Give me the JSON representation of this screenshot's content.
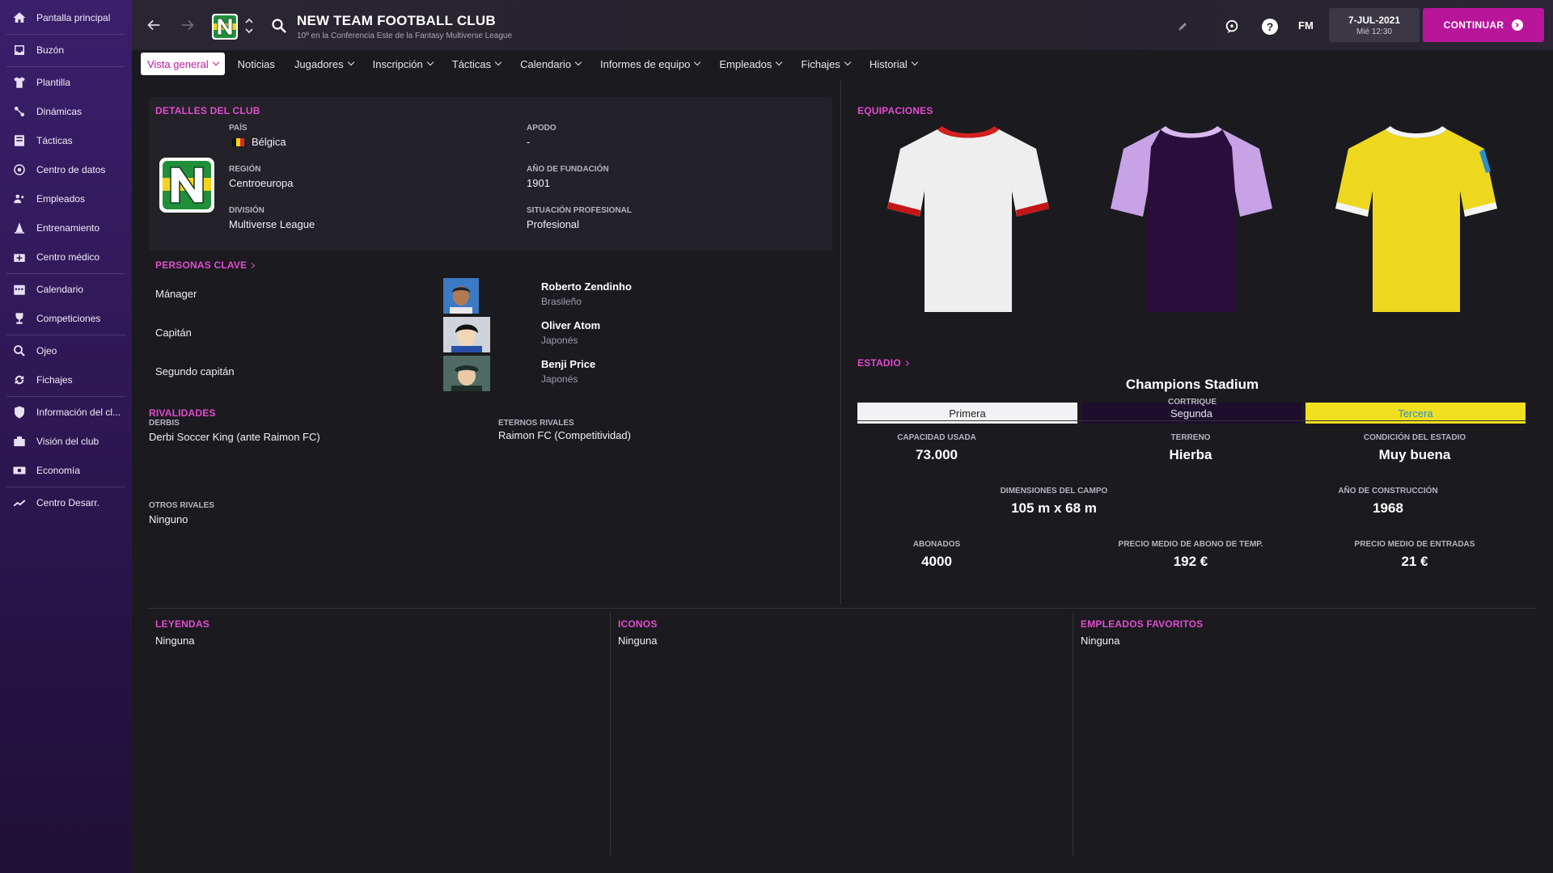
{
  "sidebar": {
    "items": [
      {
        "label": "Pantalla principal",
        "icon": "home-icon"
      },
      {
        "label": "Buzón",
        "icon": "inbox-icon"
      },
      {
        "label": "Plantilla",
        "icon": "squad-shirt-icon"
      },
      {
        "label": "Dinámicas",
        "icon": "dynamics-icon"
      },
      {
        "label": "Tácticas",
        "icon": "tactics-icon"
      },
      {
        "label": "Centro de datos",
        "icon": "data-hub-icon"
      },
      {
        "label": "Empleados",
        "icon": "staff-icon"
      },
      {
        "label": "Entrenamiento",
        "icon": "training-cone-icon"
      },
      {
        "label": "Centro médico",
        "icon": "medical-kit-icon"
      },
      {
        "label": "Calendario",
        "icon": "calendar-icon"
      },
      {
        "label": "Competiciones",
        "icon": "trophy-icon"
      },
      {
        "label": "Ojeo",
        "icon": "scouting-magnifier-icon"
      },
      {
        "label": "Fichajes",
        "icon": "transfers-icon"
      },
      {
        "label": "Información del cl...",
        "icon": "club-shield-icon"
      },
      {
        "label": "Visión del club",
        "icon": "club-vision-icon"
      },
      {
        "label": "Economía",
        "icon": "finance-icon"
      },
      {
        "label": "Centro Desarr.",
        "icon": "development-chart-icon"
      }
    ]
  },
  "header": {
    "team_name": "NEW TEAM FOOTBALL CLUB",
    "team_subtitle": "10º en la Conferencia Este de la Fantasy Multiverse League",
    "fm_logo": "FM",
    "date": "7-JUL-2021",
    "time": "Mié 12:30",
    "continue_label": "CONTINUAR"
  },
  "tabs": [
    {
      "label": "Vista general",
      "dropdown": true,
      "active": true
    },
    {
      "label": "Noticias",
      "dropdown": false,
      "active": false
    },
    {
      "label": "Jugadores",
      "dropdown": true,
      "active": false
    },
    {
      "label": "Inscripción",
      "dropdown": true,
      "active": false
    },
    {
      "label": "Tácticas",
      "dropdown": true,
      "active": false
    },
    {
      "label": "Calendario",
      "dropdown": true,
      "active": false
    },
    {
      "label": "Informes de equipo",
      "dropdown": true,
      "active": false
    },
    {
      "label": "Empleados",
      "dropdown": true,
      "active": false
    },
    {
      "label": "Fichajes",
      "dropdown": true,
      "active": false
    },
    {
      "label": "Historial",
      "dropdown": true,
      "active": false
    }
  ],
  "club_details": {
    "title": "DETALLES DEL CLUB",
    "country_label": "PAÍS",
    "country": "Bélgica",
    "nickname_label": "APODO",
    "nickname": "-",
    "region_label": "REGIÓN",
    "region": "Centroeuropa",
    "founded_label": "AÑO DE FUNDACIÓN",
    "founded": "1901",
    "division_label": "DIVISIÓN",
    "division": "Multiverse League",
    "status_label": "SITUACIÓN PROFESIONAL",
    "status": "Profesional",
    "badge_letter": "N"
  },
  "key_people": {
    "title": "PERSONAS CLAVE",
    "people": [
      {
        "role": "Mánager",
        "name": "Roberto Zendinho",
        "nationality": "Brasileño"
      },
      {
        "role": "Capitán",
        "name": "Oliver Atom",
        "nationality": "Japonés"
      },
      {
        "role": "Segundo capitán",
        "name": "Benji Price",
        "nationality": "Japonés"
      }
    ]
  },
  "rivalries": {
    "title": "RIVALIDADES",
    "derbies_label": "DERBIS",
    "derbies": "Derbi Soccer King (ante Raimon FC)",
    "eternal_label": "ETERNOS RIVALES",
    "eternal": "Raimon FC (Competitividad)",
    "other_label": "OTROS RIVALES",
    "other": "Ninguno"
  },
  "kits": {
    "title": "EQUIPACIONES",
    "items": [
      {
        "label": "Primera",
        "label_bg": "#f2f2f4",
        "label_color": "#222222"
      },
      {
        "label": "Segunda",
        "label_bg": "#1e0e2e",
        "label_color": "#e8e6ee"
      },
      {
        "label": "Tercera",
        "label_bg": "#f0e01e",
        "label_color": "#2b8fd0"
      }
    ]
  },
  "stadium": {
    "title": "ESTADIO",
    "name": "Champions Stadium",
    "location": "CORTRIQUE",
    "stats": [
      {
        "label": "CAPACIDAD USADA",
        "value": "73.000"
      },
      {
        "label": "TERRENO",
        "value": "Hierba"
      },
      {
        "label": "CONDICIÓN DEL ESTADIO",
        "value": "Muy buena"
      },
      {
        "label": "DIMENSIONES DEL CAMPO",
        "value": "105 m x 68 m"
      },
      {
        "label": "AÑO DE CONSTRUCCIÓN",
        "value": "1968"
      },
      {
        "label": "ABONADOS",
        "value": "4000"
      },
      {
        "label": "PRECIO MEDIO DE ABONO DE TEMP.",
        "value": "192 €"
      },
      {
        "label": "PRECIO MEDIO DE ENTRADAS",
        "value": "21 €"
      }
    ]
  },
  "legends": {
    "title": "LEYENDAS",
    "value": "Ninguna"
  },
  "icons": {
    "title": "ICONOS",
    "value": "Ninguna"
  },
  "favourite_staff": {
    "title": "EMPLEADOS FAVORITOS",
    "value": "Ninguna"
  },
  "colors": {
    "accent": "#e14bcf",
    "continue": "#b8159b",
    "badge_green": "#1f8f3a",
    "badge_yellow": "#f5d417"
  }
}
